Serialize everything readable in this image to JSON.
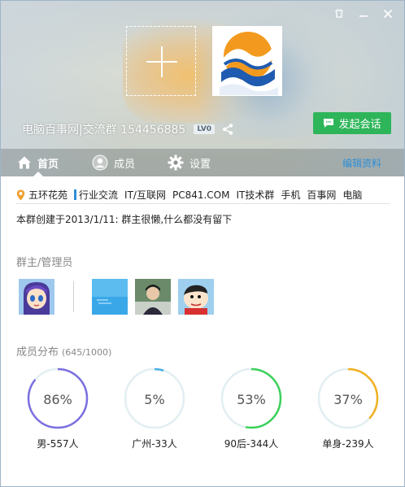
{
  "header": {
    "group_name": "电脑百事网|交流群 154456885",
    "level_badge": "LV0",
    "start_chat_label": "发起会话",
    "tabs": [
      {
        "label": "首页",
        "icon": "home-icon"
      },
      {
        "label": "成员",
        "icon": "members-icon"
      },
      {
        "label": "设置",
        "icon": "gear-icon"
      }
    ],
    "edit_label": "编辑资料"
  },
  "tags": {
    "location": "五环花苑",
    "items": [
      "行业交流",
      "IT/互联网",
      "PC841.COM",
      "IT技术群",
      "手机",
      "百事网",
      "电脑"
    ]
  },
  "intro": "本群创建于2013/1/11:  群主很懒,什么都没有留下",
  "admins": {
    "title": "群主/管理员"
  },
  "members": {
    "title": "成员分布",
    "count": "(645/1000)",
    "stats": [
      {
        "percent": "86%",
        "value": 0.86,
        "label": "男-557人",
        "color": "#7b6fe0"
      },
      {
        "percent": "5%",
        "value": 0.05,
        "label": "广州-33人",
        "color": "#4ab0e8"
      },
      {
        "percent": "53%",
        "value": 0.53,
        "label": "90后-344人",
        "color": "#3cd05a"
      },
      {
        "percent": "37%",
        "value": 0.37,
        "label": "单身-239人",
        "color": "#f0b020"
      }
    ]
  },
  "colors": {
    "accent_green": "#2eb55a",
    "link_blue": "#2e8fd8"
  }
}
